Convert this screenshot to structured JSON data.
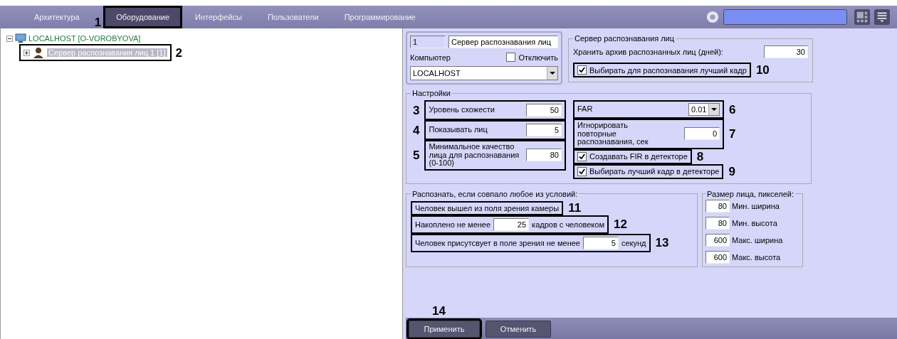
{
  "tabs": [
    {
      "label": "Архитектура",
      "selected": false
    },
    {
      "label": "Оборудование",
      "selected": true,
      "callout": "1"
    },
    {
      "label": "Интерфейсы",
      "selected": false
    },
    {
      "label": "Пользователи",
      "selected": false
    },
    {
      "label": "Программирование",
      "selected": false
    }
  ],
  "tree": {
    "label": "LOCALHOST [O-VOROBYOVA]",
    "expanded": true,
    "children": [
      {
        "label": "Сервер распознавания лиц 1 [1]",
        "selected": true,
        "expanded": false,
        "callout": "2"
      }
    ]
  },
  "object": {
    "id": "1",
    "name": "Сервер распознавания лиц",
    "computer_label": "Компьютер",
    "disable": {
      "label": "Отключить",
      "checked": false
    },
    "computer": "LOCALHOST"
  },
  "server": {
    "title": "Сервер распознавания лиц",
    "archive_label": "Хранить архив распознанных лиц (дней):",
    "archive_days": "30",
    "best_frame": {
      "label": "Выбирать для распознавания лучший кадр",
      "checked": true,
      "callout": "10"
    }
  },
  "settings": {
    "title": "Настройки",
    "left": [
      {
        "label": "Уровень схожести",
        "value": "50",
        "callout": "3"
      },
      {
        "label": "Показывать лиц",
        "value": "5",
        "callout": "4"
      },
      {
        "label": "Минимальное качество лица для распознавания (0-100)",
        "value": "80",
        "callout": "5"
      }
    ],
    "right": [
      {
        "kind": "select",
        "label": "FAR",
        "value": "0.01",
        "callout": "6"
      },
      {
        "kind": "number",
        "label": "Игнорировать повторные распознавания, сек",
        "value": "0",
        "callout": "7"
      },
      {
        "kind": "checkbox",
        "label": "Создавать FIR в детекторе",
        "checked": true,
        "callout": "8"
      },
      {
        "kind": "checkbox",
        "label": "Выбирать лучший кадр в детекторе",
        "checked": true,
        "callout": "9"
      }
    ]
  },
  "conditions": {
    "title": "Распознать, если совпало любое из условий:",
    "rows": [
      {
        "label": "Человек вышел из поля зрения камеры",
        "callout": "11"
      },
      {
        "label": "Накоплено не менее",
        "value": "25",
        "suffix": "кадров с человеком",
        "callout": "12"
      },
      {
        "label": "Человек присутсвует в поле зрения не менее",
        "value": "5",
        "suffix": "секунд",
        "callout": "13"
      }
    ]
  },
  "face_size": {
    "title": "Размер лица, пикселей:",
    "rows": [
      {
        "value": "80",
        "label": "Мин. ширина"
      },
      {
        "value": "80",
        "label": "Мин. высота"
      },
      {
        "value": "600",
        "label": "Макс. ширина"
      },
      {
        "value": "600",
        "label": "Макс. высота"
      }
    ]
  },
  "buttons": [
    {
      "label": "Применить",
      "callout": "14"
    },
    {
      "label": "Отменить"
    }
  ]
}
